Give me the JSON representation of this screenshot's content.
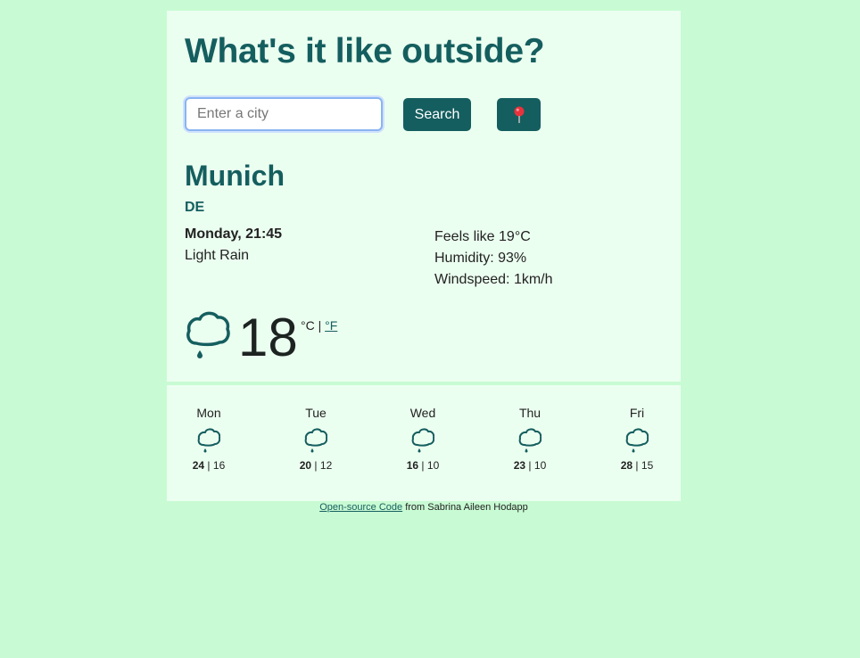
{
  "header": {
    "title": "What's it like outside?"
  },
  "search": {
    "placeholder": "Enter a city",
    "button_label": "Search"
  },
  "location_button": {
    "icon": "map-pin-icon"
  },
  "current": {
    "city": "Munich",
    "country": "DE",
    "datetime": "Monday, 21:45",
    "description": "Light Rain",
    "feels_like": "Feels like 19°C",
    "humidity": "Humidity: 93%",
    "windspeed": "Windspeed: 1km/h",
    "temperature": "18",
    "unit_celsius": "°C",
    "unit_separator": "|",
    "unit_fahrenheit": "°F",
    "icon": "rain-cloud-icon"
  },
  "forecast": [
    {
      "day": "Mon",
      "max": "24",
      "min": "16",
      "icon": "rain-cloud-icon"
    },
    {
      "day": "Tue",
      "max": "20",
      "min": "12",
      "icon": "rain-cloud-icon"
    },
    {
      "day": "Wed",
      "max": "16",
      "min": "10",
      "icon": "rain-cloud-icon"
    },
    {
      "day": "Thu",
      "max": "23",
      "min": "10",
      "icon": "rain-cloud-icon"
    },
    {
      "day": "Fri",
      "max": "28",
      "min": "15",
      "icon": "rain-cloud-icon"
    }
  ],
  "footer": {
    "link_text": "Open-source Code",
    "rest": "from Sabrina Aileen Hodapp"
  },
  "colors": {
    "background": "#c8fbd3",
    "card": "#ebfff0",
    "accent": "#155e5f"
  }
}
